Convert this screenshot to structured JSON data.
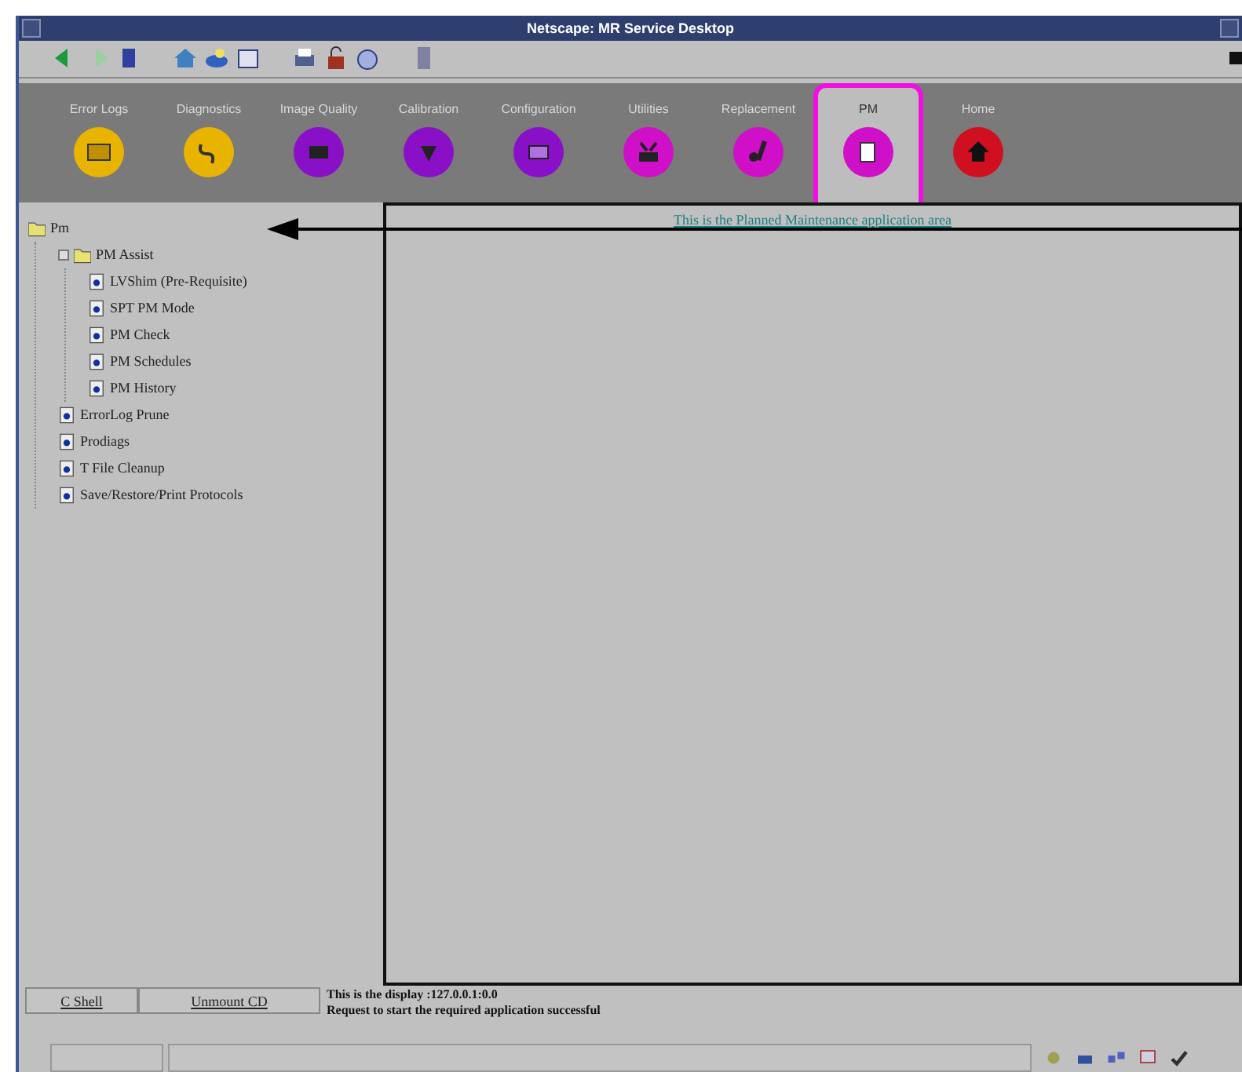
{
  "window": {
    "title": "Netscape: MR Service Desktop"
  },
  "tabs": [
    {
      "label": "Error Logs",
      "color": "#e8b400",
      "selected": false
    },
    {
      "label": "Diagnostics",
      "color": "#e8b400",
      "selected": false
    },
    {
      "label": "Image Quality",
      "color": "#8a10c8",
      "selected": false
    },
    {
      "label": "Calibration",
      "color": "#8a10c8",
      "selected": false
    },
    {
      "label": "Configuration",
      "color": "#8a10c8",
      "selected": false
    },
    {
      "label": "Utilities",
      "color": "#d010c8",
      "selected": false
    },
    {
      "label": "Replacement",
      "color": "#d010c8",
      "selected": false
    },
    {
      "label": "PM",
      "color": "#d010c8",
      "selected": true
    },
    {
      "label": "Home",
      "color": "#d01020",
      "selected": false
    }
  ],
  "tree": [
    {
      "label": "Pm",
      "kind": "folder",
      "children": [
        {
          "label": "PM Assist",
          "kind": "folder",
          "expanded": true,
          "children": [
            {
              "label": "LVShim (Pre-Requisite)",
              "kind": "document"
            },
            {
              "label": "SPT PM Mode",
              "kind": "document"
            },
            {
              "label": "PM Check",
              "kind": "document"
            },
            {
              "label": "PM Schedules",
              "kind": "document"
            },
            {
              "label": "PM History",
              "kind": "document"
            }
          ]
        },
        {
          "label": "ErrorLog Prune",
          "kind": "document"
        },
        {
          "label": "Prodiags",
          "kind": "document"
        },
        {
          "label": "T File Cleanup",
          "kind": "document"
        },
        {
          "label": "Save/Restore/Print Protocols",
          "kind": "document"
        }
      ]
    }
  ],
  "application_area": {
    "heading": "This is the Planned Maintenance application area"
  },
  "bottom_buttons": [
    "C Shell",
    "Unmount CD"
  ],
  "messages": [
    "This is the display :127.0.0.1:0.0",
    "Request to start the required application successful"
  ]
}
